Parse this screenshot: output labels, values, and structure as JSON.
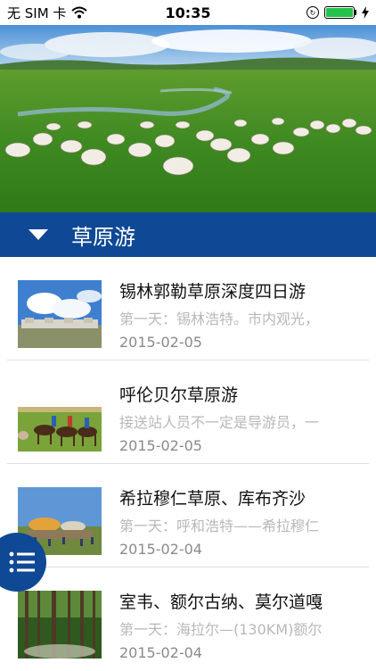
{
  "status_bar": {
    "carrier": "无 SIM 卡",
    "time": "10:35"
  },
  "header": {
    "title": "草原游"
  },
  "list": [
    {
      "title": "锡林郭勒草原深度四日游",
      "desc": "第一天：锡林浩特。市内观光，",
      "date": "2015-02-05"
    },
    {
      "title": "呼伦贝尔草原游",
      "desc": "接送站人员不一定是导游员，一",
      "date": "2015-02-05"
    },
    {
      "title": "希拉穆仁草原、库布齐沙",
      "desc": "第一天：呼和浩特——希拉穆仁",
      "date": "2015-02-04"
    },
    {
      "title": "室韦、额尔古纳、莫尔道嘎",
      "desc": "第一天：海拉尔—(130KM)额尔",
      "date": "2015-02-04"
    }
  ]
}
